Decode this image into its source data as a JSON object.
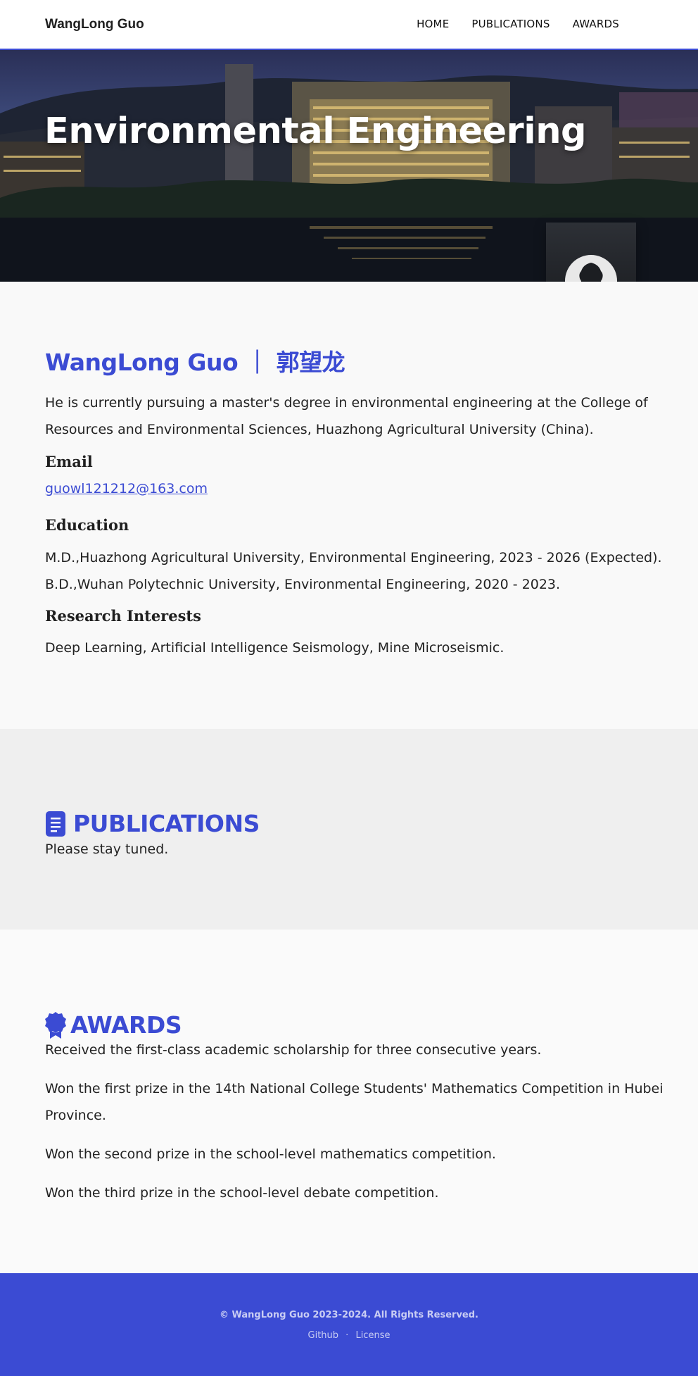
{
  "nav": {
    "brand": "WangLong Guo",
    "links": [
      {
        "label": "HOME"
      },
      {
        "label": "PUBLICATIONS"
      },
      {
        "label": "AWARDS"
      }
    ]
  },
  "hero": {
    "title": "Environmental Engineering",
    "avatar_icon": "tree-silhouette-icon"
  },
  "about": {
    "name": "WangLong Guo ｜ 郭望龙",
    "intro": "He is currently pursuing a master's degree in environmental engineering at the College of Resources and Environmental Sciences, Huazhong Agricultural University (China).",
    "email_heading": "Email",
    "email": "guowl121212@163.com",
    "education_heading": "Education",
    "education": [
      "M.D.,Huazhong Agricultural University, Environmental Engineering, 2023 - 2026 (Expected).",
      "B.D.,Wuhan Polytechnic University, Environmental Engineering, 2020 - 2023."
    ],
    "interests_heading": "Research Interests",
    "interests": "Deep Learning, Artificial Intelligence Seismology, Mine Microseismic."
  },
  "publications": {
    "title": "PUBLICATIONS",
    "icon": "document-icon",
    "text": "Please stay tuned."
  },
  "awards": {
    "title": "AWARDS",
    "icon": "award-ribbon-icon",
    "items": [
      "Received the first-class academic scholarship for three consecutive years.",
      "Won the first prize in the 14th National College Students' Mathematics Competition in Hubei Province.",
      "Won the second prize in the school-level mathematics competition.",
      "Won the third prize in the school-level debate competition."
    ]
  },
  "footer": {
    "copyright": "© WangLong Guo 2023-2024. All Rights Reserved.",
    "github": "Github",
    "separator": "·",
    "license": "License"
  },
  "colors": {
    "accent": "#3b4bd3",
    "footer_bg": "#3b4bd3",
    "publications_bg": "#efefef"
  }
}
